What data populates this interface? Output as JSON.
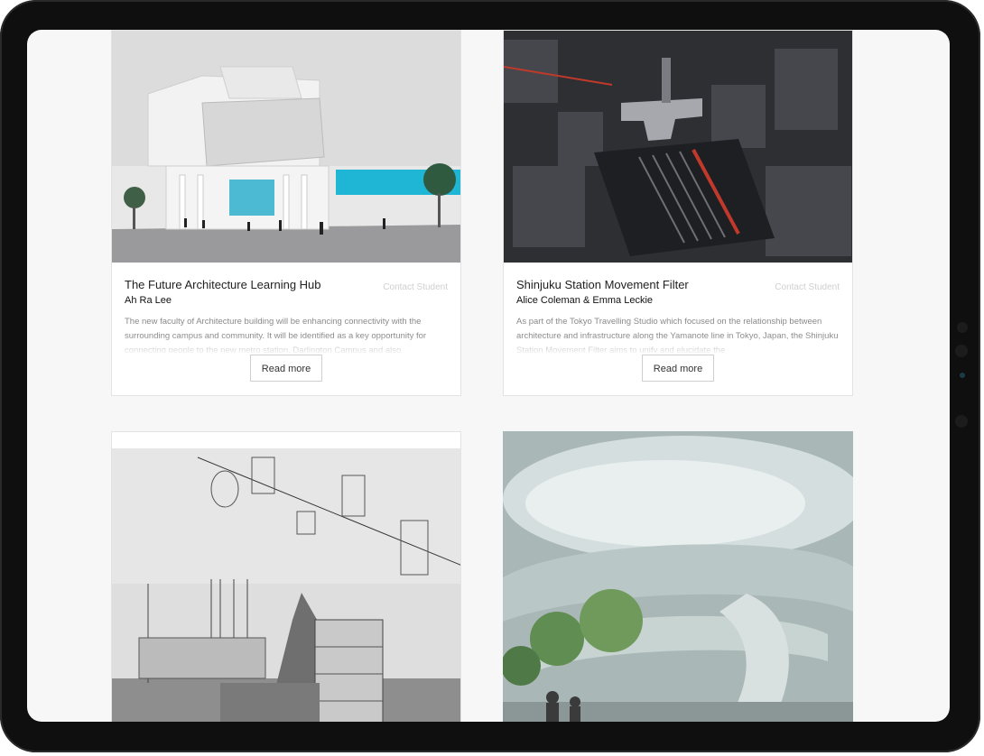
{
  "cards": [
    {
      "title": "The Future Architecture Learning Hub",
      "author": "Ah Ra Lee",
      "contact": "Contact Student",
      "description": "The new faculty of Architecture building will be enhancing connectivity with the surrounding campus and community. It will be identified as a key opportunity for connecting people to the new metro station, Darlington Campus and also",
      "button": "Read more"
    },
    {
      "title": "Shinjuku Station Movement Filter",
      "author": "Alice Coleman & Emma Leckie",
      "contact": "Contact Student",
      "description": "As part of the Tokyo Travelling Studio which focused on the relationship between architecture and infrastructure along the Yamanote line in Tokyo, Japan, the Shinjuku Station Movement Filter aims to unify and elucidate the",
      "button": "Read more"
    }
  ],
  "colors": {
    "device": "#0f0f0f",
    "screen": "#f7f7f7",
    "accent_cyan": "#1fb5d4"
  },
  "images": [
    "architecture-render-white-building",
    "shinjuku-aerial-night",
    "architectural-section-drawing",
    "spiral-ramp-render"
  ]
}
